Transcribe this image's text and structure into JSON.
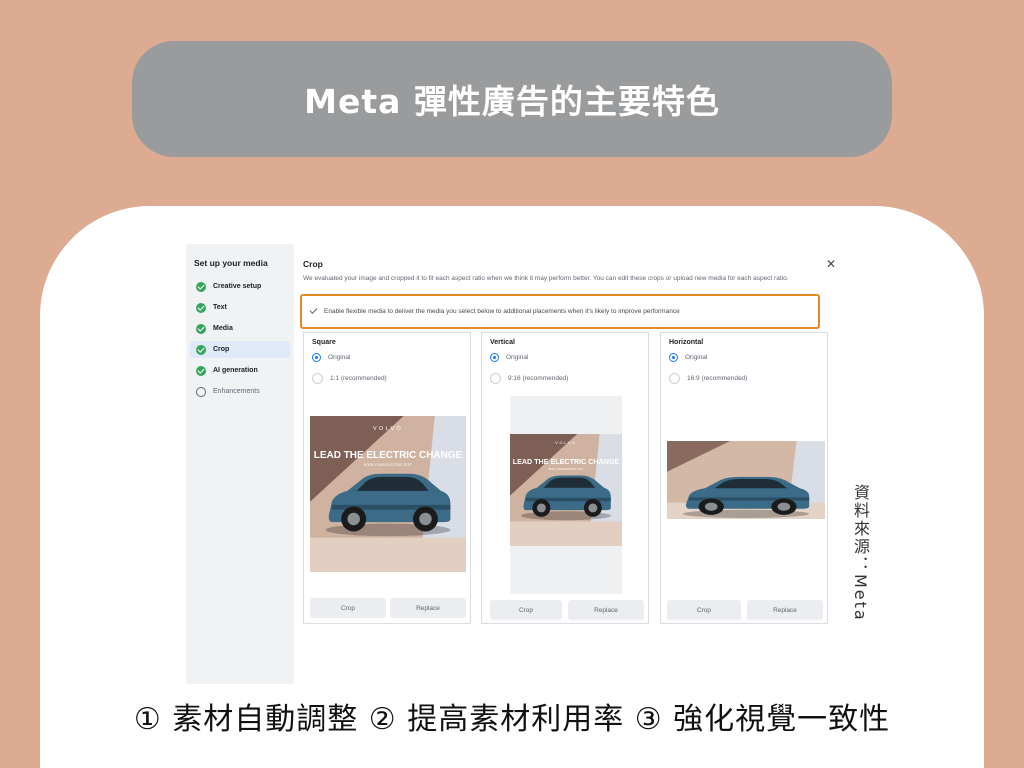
{
  "title": "Meta 彈性廣告的主要特色",
  "screenshot": {
    "sidebar": {
      "title": "Set up your media",
      "items": [
        {
          "label": "Creative setup",
          "status": "done"
        },
        {
          "label": "Text",
          "status": "done"
        },
        {
          "label": "Media",
          "status": "done"
        },
        {
          "label": "Crop",
          "status": "active"
        },
        {
          "label": "AI generation",
          "status": "done"
        },
        {
          "label": "Enhancements",
          "status": "pending"
        }
      ]
    },
    "panel": {
      "title": "Crop",
      "close_icon": "close-icon",
      "description": "We evaluated your image and cropped it to fit each aspect ratio when we think it may perform better. You can edit these crops or upload new media for each aspect ratio.",
      "flexible_media_label": "Enable flexible media to deliver the media you select below to additional placements when it's likely to improve performance",
      "flexible_media_checked": true,
      "highlight_color": "#e68a24",
      "accent_color": "#1877f2"
    },
    "ad_banner": {
      "brand": "VOLVO",
      "headline": "LEAD THE ELECTRIC CHANGE",
      "subline": "BOOK YOUR ELECTRIC TEST"
    },
    "crop_columns": [
      {
        "title": "Square",
        "option_original": "Original",
        "option_recommended": "1:1 (recommended)",
        "selected": "Original",
        "crop_button": "Crop",
        "replace_button": "Replace"
      },
      {
        "title": "Vertical",
        "option_original": "Original",
        "option_recommended": "9:16 (recommended)",
        "selected": "Original",
        "crop_button": "Crop",
        "replace_button": "Replace"
      },
      {
        "title": "Horizontal",
        "option_original": "Original",
        "option_recommended": "16:9 (recommended)",
        "selected": "Original",
        "crop_button": "Crop",
        "replace_button": "Replace"
      }
    ]
  },
  "source_note": "資料來源：Meta",
  "caption": "① 素材自動調整 ② 提高素材利用率 ③ 強化視覺一致性"
}
